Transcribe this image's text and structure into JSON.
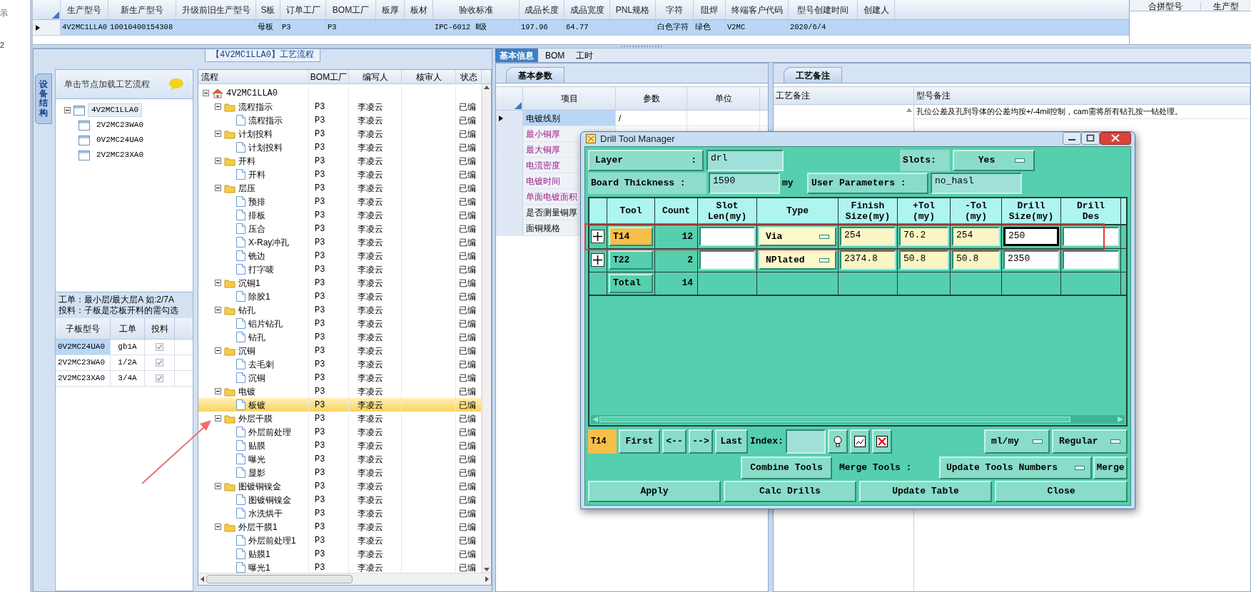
{
  "left_strip": [
    "示",
    "2"
  ],
  "product_grid": {
    "columns": [
      "生产型号",
      "新生产型号",
      "升级前旧生产型号",
      "S板",
      "订单工厂",
      "BOM工厂",
      "板厚",
      "板材",
      "验收标准",
      "成品长度",
      "成品宽度",
      "PNL规格",
      "字符",
      "阻焊",
      "终端客户代码",
      "型号创建时间",
      "创建人"
    ],
    "rows": [
      {
        "selected": true,
        "cells": [
          "4V2MC1LLA0",
          "10010400154308",
          "",
          "母板",
          "P3",
          "P3",
          "",
          "",
          "IPC-6012 Ⅱ级",
          "197.96",
          "64.77",
          "",
          "白色字符",
          "绿色",
          "V2MC",
          "2020/6/4",
          ""
        ]
      }
    ]
  },
  "merge_grid": {
    "columns": [
      "合拼型号",
      "生产型"
    ]
  },
  "flow_panel": {
    "title": "【4V2MC1LLA0】工艺流程"
  },
  "side_tab": {
    "label": "设备结构"
  },
  "structure_tree": {
    "hint": "单击节点加载工艺流程",
    "nodes": [
      {
        "label": "4V2MC1LLA0",
        "expanded": true,
        "selected": true,
        "children": [
          {
            "label": "2V2MC23WA0",
            "selected": false
          },
          {
            "label": "0V2MC24UA0",
            "selected": false
          },
          {
            "label": "2V2MC23XA0",
            "selected": false
          }
        ]
      }
    ]
  },
  "note": [
    "工单：最小层/最大层A 如:2/7A",
    "投料：子板是芯板开料的需勾选"
  ],
  "sub_board_grid": {
    "columns": [
      "子板型号",
      "工单",
      "投料"
    ],
    "rows": [
      {
        "board": "0V2MC24UA0",
        "order": "gb1A",
        "checked": true,
        "selected": true
      },
      {
        "board": "2V2MC23WA0",
        "order": "1/2A",
        "checked": true,
        "selected": false
      },
      {
        "board": "2V2MC23XA0",
        "order": "3/4A",
        "checked": true,
        "selected": false
      }
    ]
  },
  "flow_tree": {
    "columns": [
      "流程",
      "BOM工厂",
      "编写人",
      "核审人",
      "状态"
    ],
    "nodes": [
      {
        "label": "4V2MC1LLA0",
        "kind": "root",
        "expanded": true,
        "selected": false,
        "children": [
          {
            "label": "流程指示",
            "kind": "folder",
            "expanded": true,
            "selected": false,
            "bom": "P3",
            "author": "李凌云",
            "status": "已编",
            "children": [
              {
                "label": "流程指示",
                "kind": "step",
                "selected": false,
                "bom": "P3",
                "author": "李凌云",
                "status": "已编"
              }
            ]
          },
          {
            "label": "计划投料",
            "kind": "folder",
            "expanded": true,
            "selected": false,
            "bom": "P3",
            "author": "李凌云",
            "status": "已编",
            "children": [
              {
                "label": "计划投料",
                "kind": "step",
                "selected": false,
                "bom": "P3",
                "author": "李凌云",
                "status": "已编"
              }
            ]
          },
          {
            "label": "开料",
            "kind": "folder",
            "expanded": true,
            "selected": false,
            "bom": "P3",
            "author": "李凌云",
            "status": "已编",
            "children": [
              {
                "label": "开料",
                "kind": "step",
                "selected": false,
                "bom": "P3",
                "author": "李凌云",
                "status": "已编"
              }
            ]
          },
          {
            "label": "层压",
            "kind": "folder",
            "expanded": true,
            "selected": false,
            "bom": "P3",
            "author": "李凌云",
            "status": "已编",
            "children": [
              {
                "label": "预排",
                "kind": "step",
                "selected": false,
                "bom": "P3",
                "author": "李凌云",
                "status": "已编"
              },
              {
                "label": "排板",
                "kind": "step",
                "selected": false,
                "bom": "P3",
                "author": "李凌云",
                "status": "已编"
              },
              {
                "label": "压合",
                "kind": "step",
                "selected": false,
                "bom": "P3",
                "author": "李凌云",
                "status": "已编"
              },
              {
                "label": "X-Ray冲孔",
                "kind": "step",
                "selected": false,
                "bom": "P3",
                "author": "李凌云",
                "status": "已编"
              },
              {
                "label": "铣边",
                "kind": "step",
                "selected": false,
                "bom": "P3",
                "author": "李凌云",
                "status": "已编"
              },
              {
                "label": "打字唛",
                "kind": "step",
                "selected": false,
                "bom": "P3",
                "author": "李凌云",
                "status": "已编"
              }
            ]
          },
          {
            "label": "沉铜1",
            "kind": "folder",
            "expanded": true,
            "selected": false,
            "bom": "P3",
            "author": "李凌云",
            "status": "已编",
            "children": [
              {
                "label": "除胶1",
                "kind": "step",
                "selected": false,
                "bom": "P3",
                "author": "李凌云",
                "status": "已编"
              }
            ]
          },
          {
            "label": "钻孔",
            "kind": "folder",
            "expanded": true,
            "selected": false,
            "bom": "P3",
            "author": "李凌云",
            "status": "已编",
            "children": [
              {
                "label": "铝片钻孔",
                "kind": "step",
                "selected": false,
                "bom": "P3",
                "author": "李凌云",
                "status": "已编"
              },
              {
                "label": "钻孔",
                "kind": "step",
                "selected": false,
                "bom": "P3",
                "author": "李凌云",
                "status": "已编"
              }
            ]
          },
          {
            "label": "沉铜",
            "kind": "folder",
            "expanded": true,
            "selected": false,
            "bom": "P3",
            "author": "李凌云",
            "status": "已编",
            "children": [
              {
                "label": "去毛刺",
                "kind": "step",
                "selected": false,
                "bom": "P3",
                "author": "李凌云",
                "status": "已编"
              },
              {
                "label": "沉铜",
                "kind": "step",
                "selected": false,
                "bom": "P3",
                "author": "李凌云",
                "status": "已编"
              }
            ]
          },
          {
            "label": "电镀",
            "kind": "folder",
            "expanded": true,
            "selected": false,
            "bom": "P3",
            "author": "李凌云",
            "status": "已编",
            "children": [
              {
                "label": "板镀",
                "kind": "step",
                "selected": true,
                "bom": "P3",
                "author": "李凌云",
                "status": "已编"
              }
            ]
          },
          {
            "label": "外层干膜",
            "kind": "folder",
            "expanded": true,
            "selected": false,
            "bom": "P3",
            "author": "李凌云",
            "status": "已编",
            "children": [
              {
                "label": "外层前处理",
                "kind": "step",
                "selected": false,
                "bom": "P3",
                "author": "李凌云",
                "status": "已编"
              },
              {
                "label": "贴膜",
                "kind": "step",
                "selected": false,
                "bom": "P3",
                "author": "李凌云",
                "status": "已编"
              },
              {
                "label": "曝光",
                "kind": "step",
                "selected": false,
                "bom": "P3",
                "author": "李凌云",
                "status": "已编"
              },
              {
                "label": "显影",
                "kind": "step",
                "selected": false,
                "bom": "P3",
                "author": "李凌云",
                "status": "已编"
              }
            ]
          },
          {
            "label": "图镀铜镍金",
            "kind": "folder",
            "expanded": true,
            "selected": false,
            "bom": "P3",
            "author": "李凌云",
            "status": "已编",
            "children": [
              {
                "label": "图镀铜镍金",
                "kind": "step",
                "selected": false,
                "bom": "P3",
                "author": "李凌云",
                "status": "已编"
              },
              {
                "label": "水洗烘干",
                "kind": "step",
                "selected": false,
                "bom": "P3",
                "author": "李凌云",
                "status": "已编"
              }
            ]
          },
          {
            "label": "外层干膜1",
            "kind": "folder",
            "expanded": true,
            "selected": false,
            "bom": "P3",
            "author": "李凌云",
            "status": "已编",
            "children": [
              {
                "label": "外层前处理1",
                "kind": "step",
                "selected": false,
                "bom": "P3",
                "author": "李凌云",
                "status": "已编"
              },
              {
                "label": "贴膜1",
                "kind": "step",
                "selected": false,
                "bom": "P3",
                "author": "李凌云",
                "status": "已编"
              },
              {
                "label": "曝光1",
                "kind": "step",
                "selected": false,
                "bom": "P3",
                "author": "李凌云",
                "status": "已编"
              }
            ]
          }
        ]
      }
    ]
  },
  "tabs": [
    {
      "label": "基本信息",
      "selected": true
    },
    {
      "label": "BOM",
      "selected": false
    },
    {
      "label": "工时",
      "selected": false
    }
  ],
  "params_panel": {
    "tab": "基本参数",
    "columns": [
      "项目",
      "参数",
      "单位"
    ],
    "rows": [
      {
        "item": "电镀线别",
        "value": "/",
        "highlighted": false,
        "selected": true
      },
      {
        "item": "最小铜厚",
        "highlighted": true,
        "selected": false
      },
      {
        "item": "最大铜厚",
        "highlighted": true,
        "selected": false
      },
      {
        "item": "电流密度",
        "highlighted": true,
        "selected": false
      },
      {
        "item": "电镀时间",
        "highlighted": true,
        "selected": false
      },
      {
        "item": "单面电镀面积",
        "highlighted": true,
        "selected": false
      },
      {
        "item": "是否测量铜厚",
        "highlighted": false,
        "selected": false
      },
      {
        "item": "面铜规格",
        "highlighted": false,
        "selected": false
      }
    ]
  },
  "remarks_panel": {
    "tab": "工艺备注",
    "columns": [
      "工艺备注",
      "型号备注"
    ],
    "rows": [
      {
        "model_remark": "孔位公差及孔到导体的公差均按+/-4mil控制，cam需将所有钻孔按一钻处理。"
      }
    ]
  },
  "dialog": {
    "title": "Drill Tool Manager",
    "layer": {
      "label": "Layer",
      "suffix": ":",
      "value": "drl"
    },
    "slots": {
      "label": "Slots:",
      "value": "Yes"
    },
    "thickness": {
      "label": "Board Thickness :",
      "value": "1590",
      "unit": "my"
    },
    "user_params": {
      "label": "User Parameters :",
      "value": "no_hasl"
    },
    "columns": [
      [
        "Tool"
      ],
      [
        "Count"
      ],
      [
        "Slot",
        "Len(my)"
      ],
      [
        "Type"
      ],
      [
        "Finish",
        "Size(my)"
      ],
      [
        "+Tol",
        "(my)"
      ],
      [
        "-Tol",
        "(my)"
      ],
      [
        "Drill",
        "Size(my)"
      ],
      [
        "Drill",
        "Des"
      ]
    ],
    "tools": [
      {
        "tool": "T14",
        "selected": true,
        "count": "12",
        "type": "Via",
        "finish": "254",
        "plus_tol": "76.2",
        "minus_tol": "254",
        "drill_size": "250",
        "focused": true
      },
      {
        "tool": "T22",
        "selected": false,
        "count": "2",
        "type": "NPlated",
        "finish": "2374.8",
        "plus_tol": "50.8",
        "minus_tol": "50.8",
        "drill_size": "2350",
        "focused": false
      }
    ],
    "total": {
      "label": "Total",
      "count": "14"
    },
    "current_tool": "T14",
    "nav": [
      "First",
      "<--",
      "-->",
      "Last"
    ],
    "index_label": "Index:",
    "units": "ml/my",
    "mode": "Regular",
    "combine": "Combine Tools",
    "merge_label": "Merge Tools :",
    "merge_option": "Update Tools Numbers",
    "merge": "Merge",
    "actions": [
      "Apply",
      "Calc Drills",
      "Update Table",
      "Close"
    ]
  }
}
